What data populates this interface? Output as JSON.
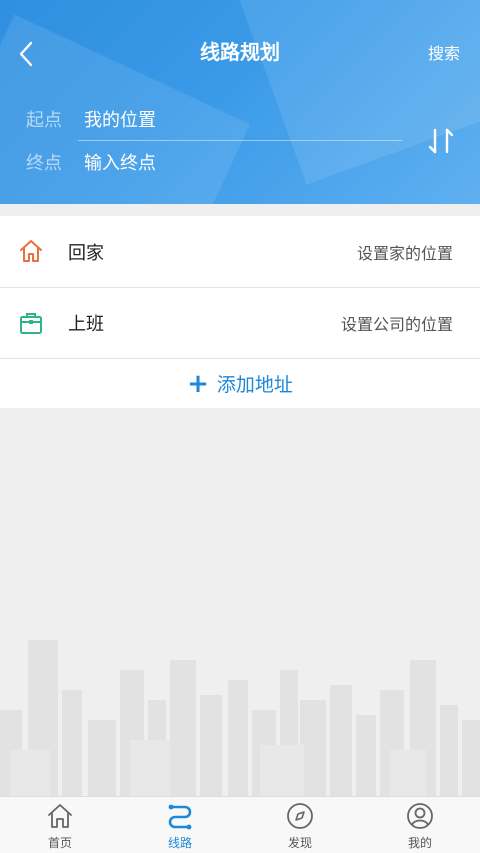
{
  "header": {
    "title": "线路规划",
    "search_label": "搜索",
    "start_label": "起点",
    "start_value": "我的位置",
    "end_label": "终点",
    "end_placeholder": "输入终点"
  },
  "shortcuts": [
    {
      "name": "回家",
      "hint": "设置家的位置",
      "icon": "home-icon",
      "color": "#e8703a"
    },
    {
      "name": "上班",
      "hint": "设置公司的位置",
      "icon": "briefcase-icon",
      "color": "#2fb38a"
    }
  ],
  "add_address_label": "添加地址",
  "tabs": [
    {
      "label": "首页",
      "icon": "home-tab-icon",
      "active": false
    },
    {
      "label": "线路",
      "icon": "route-tab-icon",
      "active": true
    },
    {
      "label": "发现",
      "icon": "compass-icon",
      "active": false
    },
    {
      "label": "我的",
      "icon": "user-icon",
      "active": false
    }
  ],
  "colors": {
    "accent": "#1e88d8",
    "header_blue": "#3a9ae8"
  }
}
